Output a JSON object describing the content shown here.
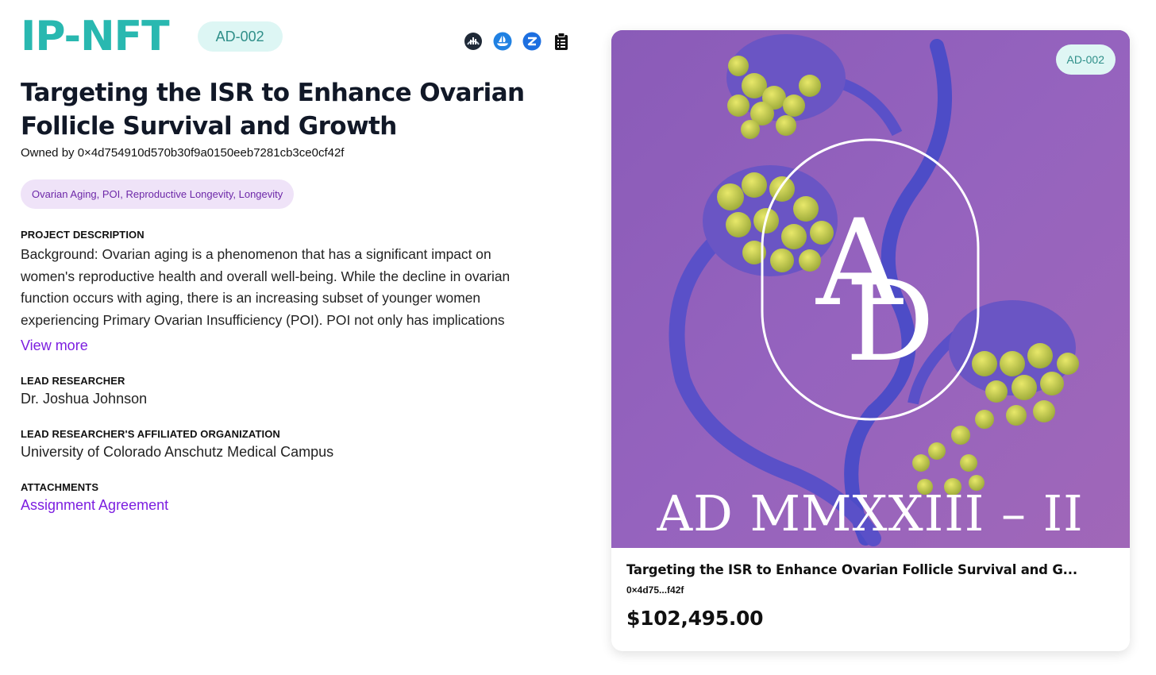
{
  "header": {
    "brand": "IP-NFT",
    "id_badge": "AD-002",
    "icons": [
      "chart-icon",
      "opensea-icon",
      "zora-icon",
      "clipboard-icon"
    ]
  },
  "project": {
    "title": "Targeting the ISR to Enhance Ovarian Follicle Survival and Growth",
    "owner_prefix": "Owned by",
    "owner_address": "0×4d754910d570b30f9a0150eeb7281cb3ce0cf42f",
    "tags": "Ovarian Aging, POI, Reproductive Longevity, Longevity",
    "description_label": "PROJECT DESCRIPTION",
    "description": "Background: Ovarian aging is a phenomenon that has a significant impact on women's reproductive health and overall well-being. While the decline in ovarian function occurs with aging, there is an increasing subset of younger women experiencing Primary Ovarian Insufficiency (POI). POI not only has implications",
    "view_more": "View more",
    "lead_researcher_label": "LEAD RESEARCHER",
    "lead_researcher": "Dr. Joshua Johnson",
    "organization_label": "LEAD RESEARCHER'S AFFILIATED ORGANIZATION",
    "organization": "University of Colorado Anschutz Medical Campus",
    "attachments_label": "ATTACHMENTS",
    "attachment": "Assignment Agreement"
  },
  "card": {
    "badge": "AD-002",
    "art_monogram_a": "A",
    "art_monogram_d": "D",
    "art_caption": "AD MMXXIII – II",
    "title": "Targeting the ISR to Enhance Ovarian Follicle Survival and G...",
    "address": "0×4d75...f42f",
    "price": "$102,495.00"
  },
  "colors": {
    "brand": "#29b8b0",
    "accent_link": "#7c1ee0",
    "art_background": "#8e5fb8"
  }
}
